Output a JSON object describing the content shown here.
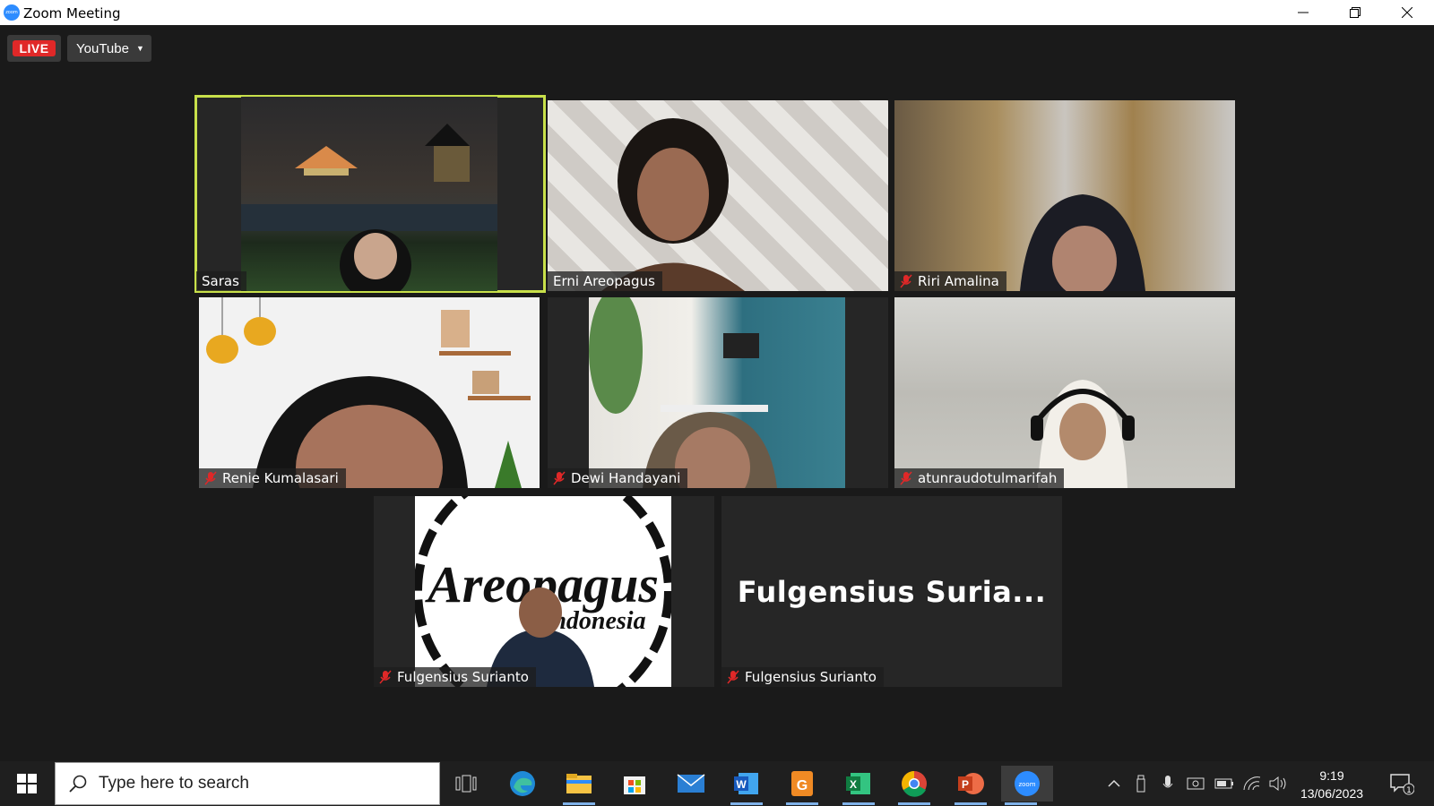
{
  "window": {
    "title": "Zoom Meeting"
  },
  "toolbar": {
    "live_label": "LIVE",
    "stream_target": "YouTube"
  },
  "participants": [
    {
      "name": "Saras",
      "muted": false,
      "active_speaker": true
    },
    {
      "name": "Erni Areopagus",
      "muted": false
    },
    {
      "name": "Riri Amalina",
      "muted": true
    },
    {
      "name": "Renie Kumalasari",
      "muted": true
    },
    {
      "name": "Dewi Handayani",
      "muted": true
    },
    {
      "name": "atunraudotulmarifah",
      "muted": true
    },
    {
      "name": "Fulgensius Surianto",
      "muted": true,
      "background_text": "Areopagus Indonesia"
    },
    {
      "name": "Fulgensius Surianto",
      "muted": true,
      "display_name": "Fulgensius  Suria..."
    }
  ],
  "taskbar": {
    "search_placeholder": "Type here to search",
    "time": "9:19",
    "date": "13/06/2023",
    "notification_count": "1",
    "apps": [
      "task-view",
      "edge",
      "file-explorer",
      "microsoft-store",
      "mail",
      "word",
      "pdf-reader",
      "excel",
      "chrome",
      "powerpoint",
      "zoom"
    ]
  },
  "colors": {
    "active_speaker_border": "#c8e04a",
    "live_red": "#e02828",
    "zoom_blue": "#2d8cff"
  }
}
